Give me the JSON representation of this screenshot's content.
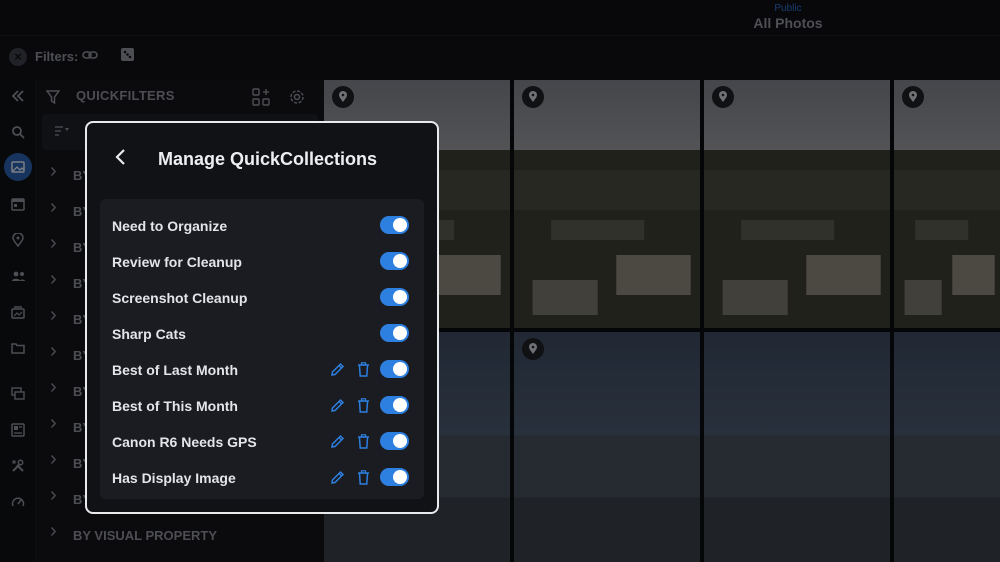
{
  "header": {
    "album_scope": "Public",
    "album_title": "All Photos"
  },
  "filters": {
    "label": "Filters:",
    "icons": [
      "clear-filters-icon",
      "link-icon",
      "dice-icon"
    ]
  },
  "rail": {
    "items": [
      "collapse-icon",
      "search-icon",
      "photos-icon",
      "calendar-icon",
      "location-icon",
      "people-icon",
      "albums-icon",
      "folder-icon",
      "collections-icon",
      "layout-icon",
      "tools-icon",
      "dashboard-icon"
    ],
    "active": "photos-icon"
  },
  "panel": {
    "title": "QUICKFILTERS",
    "groups": [
      "BY",
      "BY",
      "BY",
      "BY",
      "BY",
      "BY",
      "BY",
      "BY",
      "BY",
      "BY",
      "BY VISUAL PROPERTY"
    ]
  },
  "dialog": {
    "title": "Manage QuickCollections",
    "items": [
      {
        "label": "Need to Organize",
        "enabled": true,
        "editable": false
      },
      {
        "label": "Review for Cleanup",
        "enabled": true,
        "editable": false
      },
      {
        "label": "Screenshot Cleanup",
        "enabled": true,
        "editable": false
      },
      {
        "label": "Sharp Cats",
        "enabled": true,
        "editable": false
      },
      {
        "label": "Best of Last Month",
        "enabled": true,
        "editable": true
      },
      {
        "label": "Best of This Month",
        "enabled": true,
        "editable": true
      },
      {
        "label": "Canon R6 Needs GPS",
        "enabled": true,
        "editable": true
      },
      {
        "label": "Has Display Image",
        "enabled": true,
        "editable": true
      }
    ]
  },
  "colors": {
    "accent": "#2d7fe0",
    "active_rail": "#2a5fae"
  }
}
